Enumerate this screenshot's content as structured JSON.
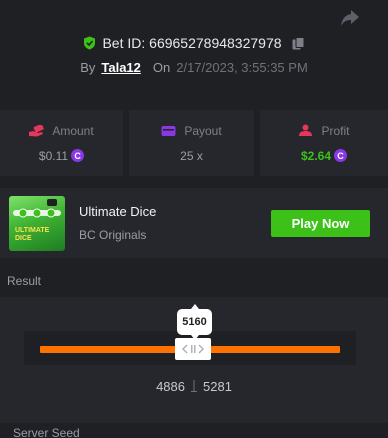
{
  "bet": {
    "id_label": "Bet ID: 66965278948327978",
    "by_label": "By",
    "user": "Tala12",
    "on_label": "On",
    "date": "2/17/2023, 3:55:35 PM"
  },
  "stats": [
    {
      "label": "Amount",
      "value": "$0.11",
      "icon": "money-hand-icon"
    },
    {
      "label": "Payout",
      "value": "25 x",
      "icon": "wallet-icon"
    },
    {
      "label": "Profit",
      "value": "$2.64",
      "icon": "user-profit-icon"
    }
  ],
  "coin_symbol": "C",
  "game": {
    "name": "Ultimate Dice",
    "provider": "BC Originals",
    "thumb_text": "ULTIMATE DICE",
    "play_label": "Play Now"
  },
  "result": {
    "label": "Result",
    "roll": "5160",
    "range_low": "4886",
    "range_high": "5281",
    "handle_glyph": "‹ ||›"
  },
  "server_seed_label": "Server Seed",
  "colors": {
    "background": "#1e2024",
    "panel": "#25272c",
    "green": "#3bc117",
    "orange": "#ff7200",
    "purple": "#8a38e6",
    "red": "#e6365b"
  }
}
